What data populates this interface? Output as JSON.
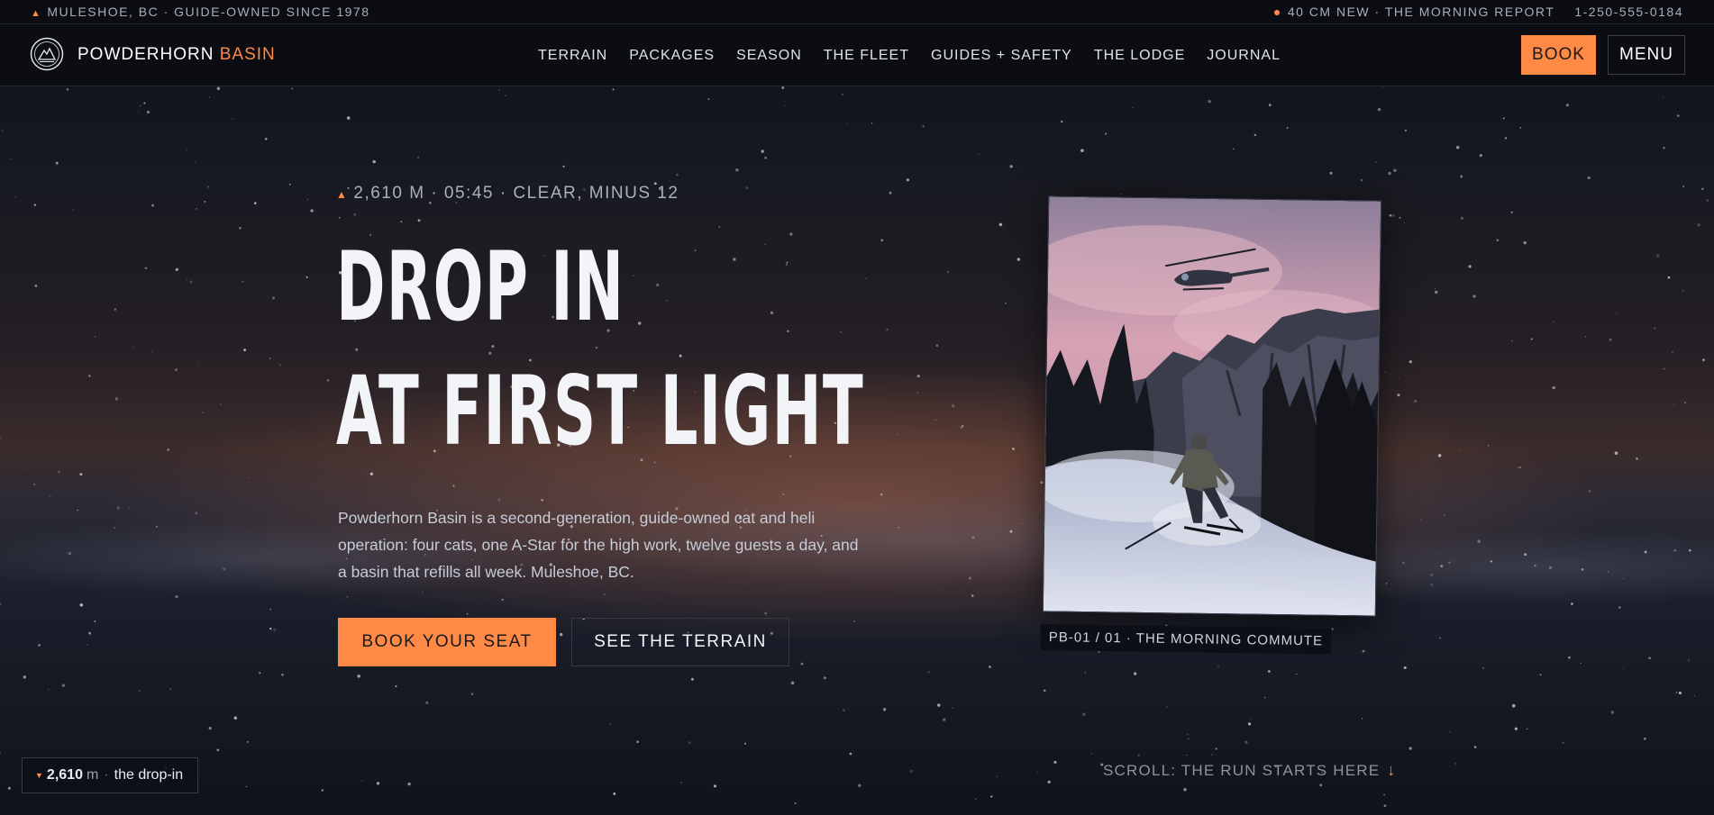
{
  "topbar": {
    "location": "MULESHOE, BC · GUIDE-OWNED SINCE 1978",
    "snow_report": "40 CM NEW · THE MORNING REPORT",
    "phone": "1-250-555-0184"
  },
  "nav": {
    "brand_first": "POWDERHORN",
    "brand_second": "BASIN",
    "items": [
      {
        "label": "TERRAIN"
      },
      {
        "label": "PACKAGES"
      },
      {
        "label": "SEASON"
      },
      {
        "label": "THE FLEET"
      },
      {
        "label": "GUIDES + SAFETY"
      },
      {
        "label": "THE LODGE"
      },
      {
        "label": "JOURNAL"
      }
    ],
    "book_label": "BOOK",
    "menu_label": "MENU"
  },
  "hero": {
    "eyebrow": "2,610 M · 05:45 · CLEAR, MINUS 12",
    "headline_line1": "DROP IN",
    "headline_line2": "AT FIRST LIGHT",
    "lede": "Powderhorn Basin is a second-generation, guide-owned cat and heli operation: four cats, one A-Star for the high work, twelve guests a day, and a basin that refills all week. Muleshoe, BC.",
    "primary_cta": "BOOK YOUR SEAT",
    "secondary_cta": "SEE THE TERRAIN"
  },
  "photo": {
    "caption": "PB-01 / 01 · THE MORNING COMMUTE"
  },
  "altitude_badge": {
    "value": "2,610",
    "unit": "m",
    "label": "the drop-in"
  },
  "scroll_cue": {
    "label": "SCROLL: THE RUN STARTS HERE"
  },
  "colors": {
    "accent": "#ff8a45",
    "bar": "#0b0d13"
  },
  "icons": {
    "brand_logo": "mountain-badge-icon",
    "location_marker": "triangle-icon",
    "live_indicator": "dot-icon",
    "scroll_arrow": "arrow-down-icon"
  }
}
